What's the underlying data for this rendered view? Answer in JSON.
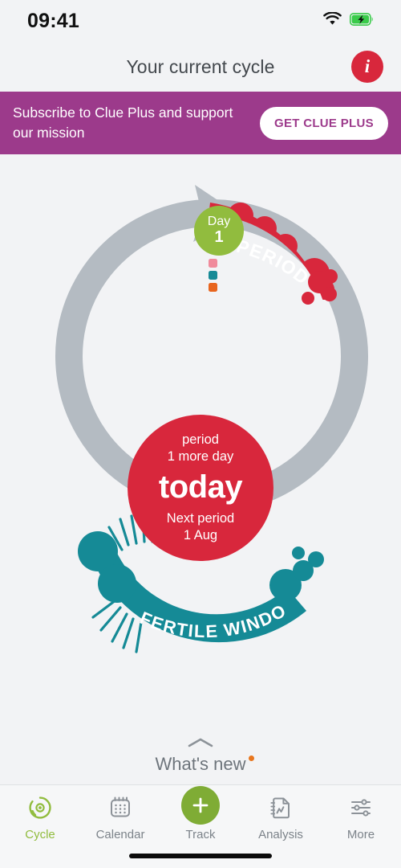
{
  "status_bar": {
    "time": "09:41",
    "wifi_icon": "wifi-icon",
    "battery_icon": "battery-charging-icon",
    "battery_color": "#3ACB4A"
  },
  "header": {
    "title": "Your current cycle",
    "info_button_glyph": "i",
    "info_button_color": "#D8273C"
  },
  "promo": {
    "message": "Subscribe to Clue Plus and support our mission",
    "cta_label": "GET CLUE PLUS",
    "background_color": "#9C3A8B",
    "cta_text_color": "#9C3A8B"
  },
  "cycle": {
    "ring_color": "#B4BBC2",
    "center": {
      "phase_label": "period",
      "phase_remaining": "1 more day",
      "today_label": "today",
      "next_period_label": "Next period",
      "next_period_date": "1 Aug",
      "color": "#D8273C"
    },
    "day_marker": {
      "label": "Day",
      "number": "1",
      "color": "#91BC3E"
    },
    "tracked_dots": [
      {
        "name": "pink-tracked-dot",
        "color": "#F08A9B"
      },
      {
        "name": "teal-tracked-dot",
        "color": "#168A96"
      },
      {
        "name": "orange-tracked-dot",
        "color": "#E8651E"
      }
    ],
    "period_band": {
      "label": "PERIOD",
      "color": "#D8273C"
    },
    "fertile_band": {
      "label": "FERTILE WINDOW",
      "color": "#158A96"
    }
  },
  "whats_new": {
    "label": "What's new",
    "chevron_icon": "chevron-up-icon",
    "badge_color": "#E8761E",
    "has_badge": true
  },
  "tabbar": {
    "items": [
      {
        "label": "Cycle",
        "icon": "cycle-icon",
        "active": true
      },
      {
        "label": "Calendar",
        "icon": "calendar-icon",
        "active": false
      },
      {
        "label": "Track",
        "icon": "plus-icon",
        "active": false
      },
      {
        "label": "Analysis",
        "icon": "analysis-icon",
        "active": false
      },
      {
        "label": "More",
        "icon": "sliders-icon",
        "active": false
      }
    ],
    "active_color": "#91BC3E",
    "inactive_color": "#7C838A"
  }
}
